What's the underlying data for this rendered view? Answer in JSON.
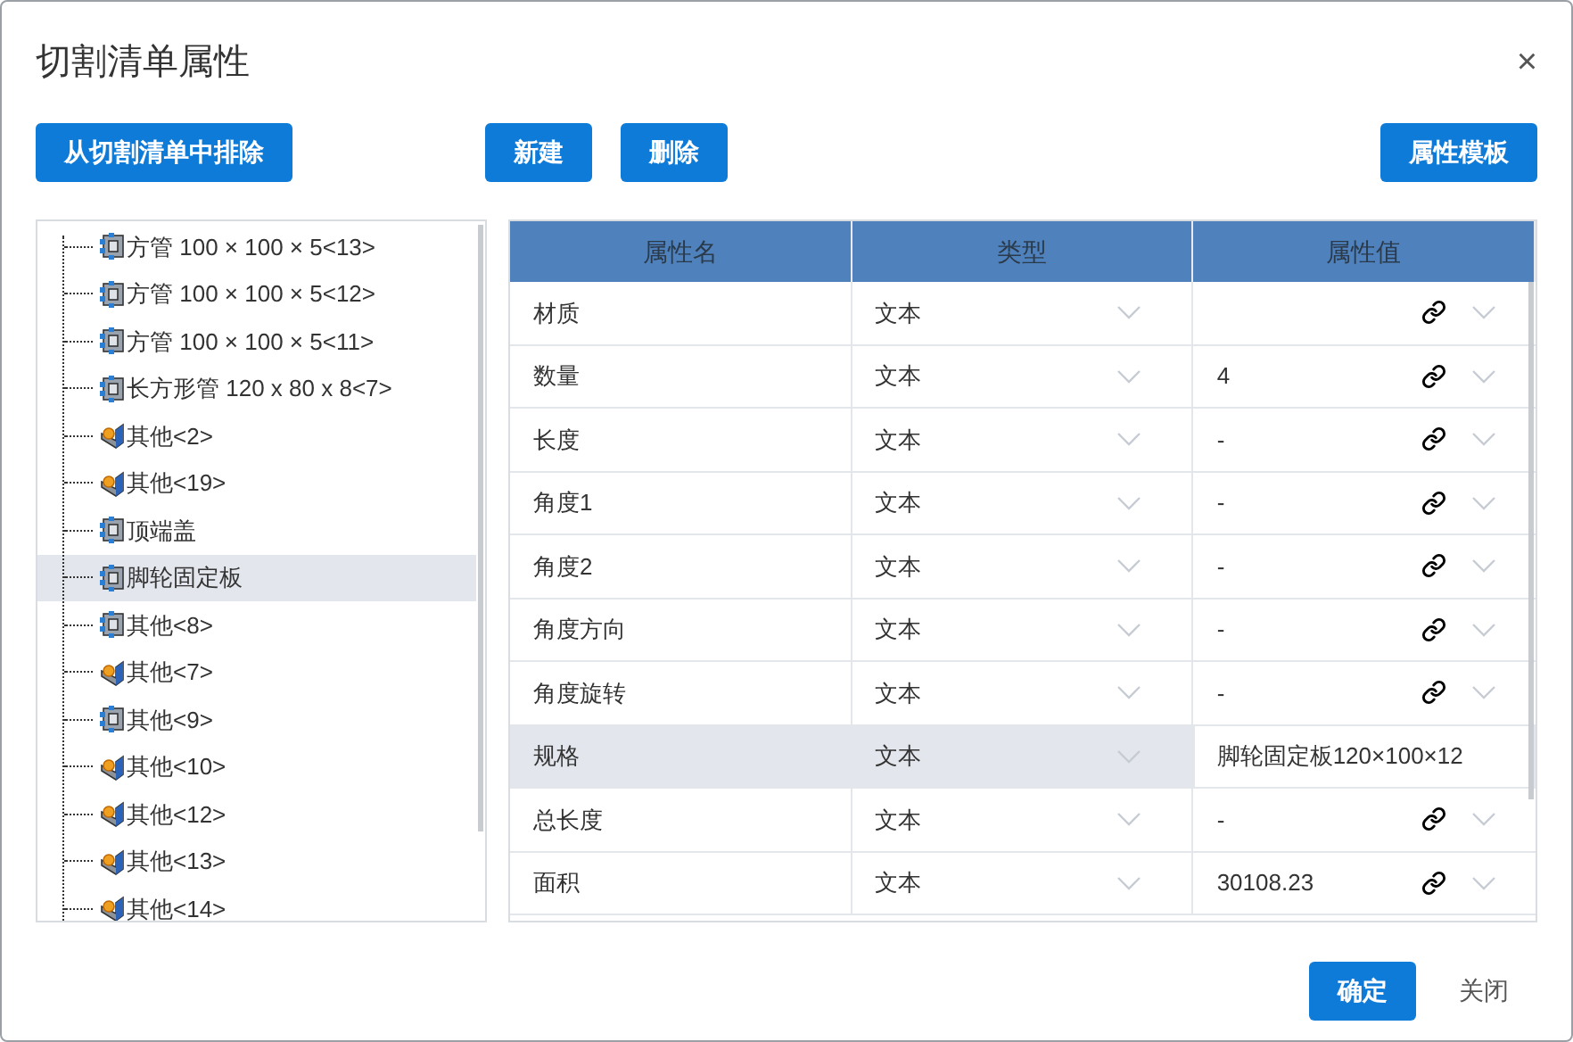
{
  "window": {
    "title": "切割清单属性",
    "close": "×"
  },
  "toolbar": {
    "exclude": "从切割清单中排除",
    "new": "新建",
    "delete": "删除",
    "template": "属性模板"
  },
  "tree": [
    {
      "label": "方管 100 × 100 × 5<13>",
      "kind": "part",
      "selected": false
    },
    {
      "label": "方管 100 × 100 × 5<12>",
      "kind": "part",
      "selected": false
    },
    {
      "label": "方管 100 × 100 × 5<11>",
      "kind": "part",
      "selected": false
    },
    {
      "label": "长方形管 120 x 80 x 8<7>",
      "kind": "part",
      "selected": false
    },
    {
      "label": "其他<2>",
      "kind": "other",
      "selected": false
    },
    {
      "label": "其他<19>",
      "kind": "other",
      "selected": false
    },
    {
      "label": "顶端盖",
      "kind": "part",
      "selected": false
    },
    {
      "label": "脚轮固定板",
      "kind": "part",
      "selected": true
    },
    {
      "label": "其他<8>",
      "kind": "part",
      "selected": false
    },
    {
      "label": "其他<7>",
      "kind": "other",
      "selected": false
    },
    {
      "label": "其他<9>",
      "kind": "part",
      "selected": false
    },
    {
      "label": "其他<10>",
      "kind": "other",
      "selected": false
    },
    {
      "label": "其他<12>",
      "kind": "other",
      "selected": false
    },
    {
      "label": "其他<13>",
      "kind": "other",
      "selected": false
    },
    {
      "label": "其他<14>",
      "kind": "other",
      "selected": false
    }
  ],
  "table": {
    "columns": [
      "属性名",
      "类型",
      "属性值"
    ],
    "rows": [
      {
        "name": "材质",
        "type": "文本",
        "value": "",
        "selected": false,
        "editing": false
      },
      {
        "name": "数量",
        "type": "文本",
        "value": "4",
        "selected": false,
        "editing": false
      },
      {
        "name": "长度",
        "type": "文本",
        "value": "-",
        "selected": false,
        "editing": false
      },
      {
        "name": "角度1",
        "type": "文本",
        "value": "-",
        "selected": false,
        "editing": false
      },
      {
        "name": "角度2",
        "type": "文本",
        "value": "-",
        "selected": false,
        "editing": false
      },
      {
        "name": "角度方向",
        "type": "文本",
        "value": "-",
        "selected": false,
        "editing": false
      },
      {
        "name": "角度旋转",
        "type": "文本",
        "value": "-",
        "selected": false,
        "editing": false
      },
      {
        "name": "规格",
        "type": "文本",
        "value": "脚轮固定板120×100×12",
        "selected": true,
        "editing": true
      },
      {
        "name": "总长度",
        "type": "文本",
        "value": "-",
        "selected": false,
        "editing": false
      },
      {
        "name": "面积",
        "type": "文本",
        "value": "30108.23",
        "selected": false,
        "editing": false
      }
    ]
  },
  "footer": {
    "ok": "确定",
    "close": "关闭"
  }
}
